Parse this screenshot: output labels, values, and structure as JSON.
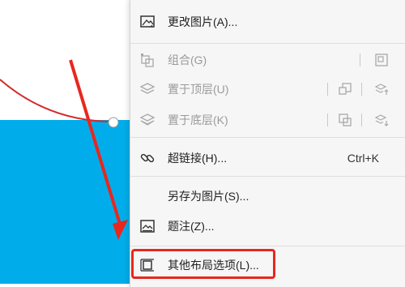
{
  "menu": {
    "items": [
      {
        "id": "change-picture",
        "label": "更改图片(A)...",
        "icon": "change-picture-icon",
        "enabled": true
      },
      {
        "id": "group",
        "label": "组合(G)",
        "icon": "group-icon",
        "enabled": false
      },
      {
        "id": "bring-to-front",
        "label": "置于顶层(U)",
        "icon": "layers-up-icon",
        "enabled": false
      },
      {
        "id": "send-to-back",
        "label": "置于底层(K)",
        "icon": "layers-down-icon",
        "enabled": false
      },
      {
        "id": "hyperlink",
        "label": "超链接(H)...",
        "icon": "link-icon",
        "enabled": true,
        "shortcut": "Ctrl+K"
      },
      {
        "id": "save-as-picture",
        "label": "另存为图片(S)...",
        "enabled": true
      },
      {
        "id": "caption",
        "label": "题注(Z)...",
        "icon": "caption-icon",
        "enabled": true
      },
      {
        "id": "more-layout",
        "label": "其他布局选项(L)...",
        "icon": "layout-options-icon",
        "enabled": true,
        "highlighted": true
      }
    ]
  },
  "colors": {
    "doc_blue": "#00adea",
    "annotation_red": "#e8271e",
    "menu_bg": "#f6f6f6"
  }
}
